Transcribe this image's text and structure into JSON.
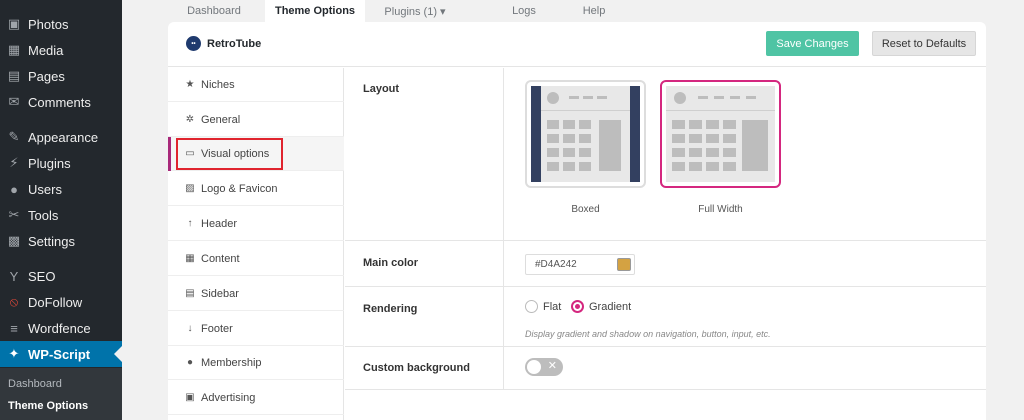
{
  "wp_menu": {
    "items": [
      {
        "label": "Photos",
        "icon": "photos-icon",
        "glyph": "▣"
      },
      {
        "label": "Media",
        "icon": "media-icon",
        "glyph": "▦"
      },
      {
        "label": "Pages",
        "icon": "pages-icon",
        "glyph": "▤"
      },
      {
        "label": "Comments",
        "icon": "comments-icon",
        "glyph": "✉"
      },
      {
        "label": "Appearance",
        "icon": "appearance-icon",
        "glyph": "✎"
      },
      {
        "label": "Plugins",
        "icon": "plugins-icon",
        "glyph": "⚡"
      },
      {
        "label": "Users",
        "icon": "users-icon",
        "glyph": "●"
      },
      {
        "label": "Tools",
        "icon": "tools-icon",
        "glyph": "✂"
      },
      {
        "label": "Settings",
        "icon": "settings-icon",
        "glyph": "▩"
      },
      {
        "label": "SEO",
        "icon": "seo-icon",
        "glyph": "Y"
      },
      {
        "label": "DoFollow",
        "icon": "dofollow-icon",
        "glyph": "⦸"
      },
      {
        "label": "Wordfence",
        "icon": "wordfence-icon",
        "glyph": "≡"
      },
      {
        "label": "WP-Script",
        "icon": "wp-script-icon",
        "glyph": "✦"
      }
    ],
    "submenu": {
      "dashboard": "Dashboard",
      "theme_options": "Theme Options"
    }
  },
  "tabs": [
    {
      "label": "Dashboard"
    },
    {
      "label": "Theme Options"
    },
    {
      "label": "Plugins (1) ▾"
    },
    {
      "label": "Logs"
    },
    {
      "label": "Help"
    }
  ],
  "header": {
    "logo_text": "RetroTube",
    "save_label": "Save Changes",
    "reset_label": "Reset to Defaults"
  },
  "settings_menu": [
    {
      "label": "Niches",
      "glyph": "★"
    },
    {
      "label": "General",
      "glyph": "✲"
    },
    {
      "label": "Visual options",
      "glyph": "▭"
    },
    {
      "label": "Logo & Favicon",
      "glyph": "▨"
    },
    {
      "label": "Header",
      "glyph": "↑"
    },
    {
      "label": "Content",
      "glyph": "▦"
    },
    {
      "label": "Sidebar",
      "glyph": "▤"
    },
    {
      "label": "Footer",
      "glyph": "↓"
    },
    {
      "label": "Membership",
      "glyph": "●"
    },
    {
      "label": "Advertising",
      "glyph": "▣"
    }
  ],
  "visual": {
    "layout_label": "Layout",
    "boxed_label": "Boxed",
    "full_width_label": "Full Width",
    "main_color_label": "Main color",
    "main_color_value": "#D4A242",
    "rendering_label": "Rendering",
    "flat_label": "Flat",
    "gradient_label": "Gradient",
    "rendering_hint": "Display gradient and shadow on navigation, button, input, etc.",
    "custom_bg_label": "Custom background",
    "toggle_glyph": "✕"
  },
  "colors": {
    "accent": "#d4277f",
    "save_button": "#4fc4a4",
    "wp_active": "#0073aa",
    "main_color": "#D4A242",
    "highlight_box": "#e0242e"
  }
}
